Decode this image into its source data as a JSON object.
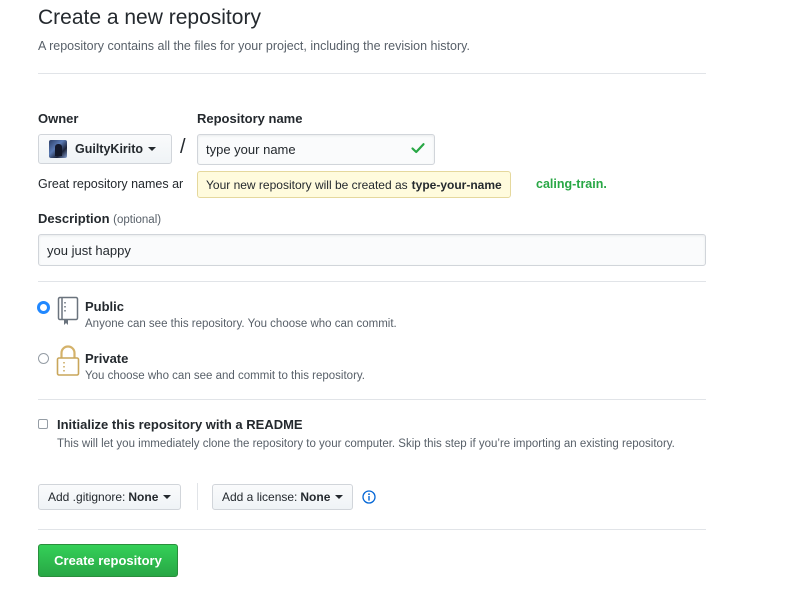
{
  "header": {
    "title": "Create a new repository",
    "subtitle": "A repository contains all the files for your project, including the revision history."
  },
  "owner": {
    "label": "Owner",
    "value": "GuiltyKirito"
  },
  "repository": {
    "label": "Repository name",
    "value": "type your name",
    "hint": "Great repository names ar",
    "hint_tail": "caling-train.",
    "tooltip_text": "Your new repository will be created as",
    "tooltip_name": "type-your-name"
  },
  "description": {
    "label": "Description",
    "optional": "(optional)",
    "value": "you just happy"
  },
  "visibility": {
    "public_title": "Public",
    "public_desc": "Anyone can see this repository. You choose who can commit.",
    "private_title": "Private",
    "private_desc": "You choose who can see and commit to this repository.",
    "selected": "Public"
  },
  "readme": {
    "title": "Initialize this repository with a README",
    "desc": "This will let you immediately clone the repository to your computer. Skip this step if you’re importing an existing repository.",
    "checked": false
  },
  "gitignore": {
    "prefix": "Add .gitignore:",
    "value": "None"
  },
  "license": {
    "prefix": "Add a license:",
    "value": "None"
  },
  "actions": {
    "create_label": "Create repository"
  },
  "colors": {
    "primary_button": "#28a745",
    "link_blue": "#0366d6",
    "radio_selected": "#2188ff",
    "tooltip_bg": "#fffbdd"
  }
}
